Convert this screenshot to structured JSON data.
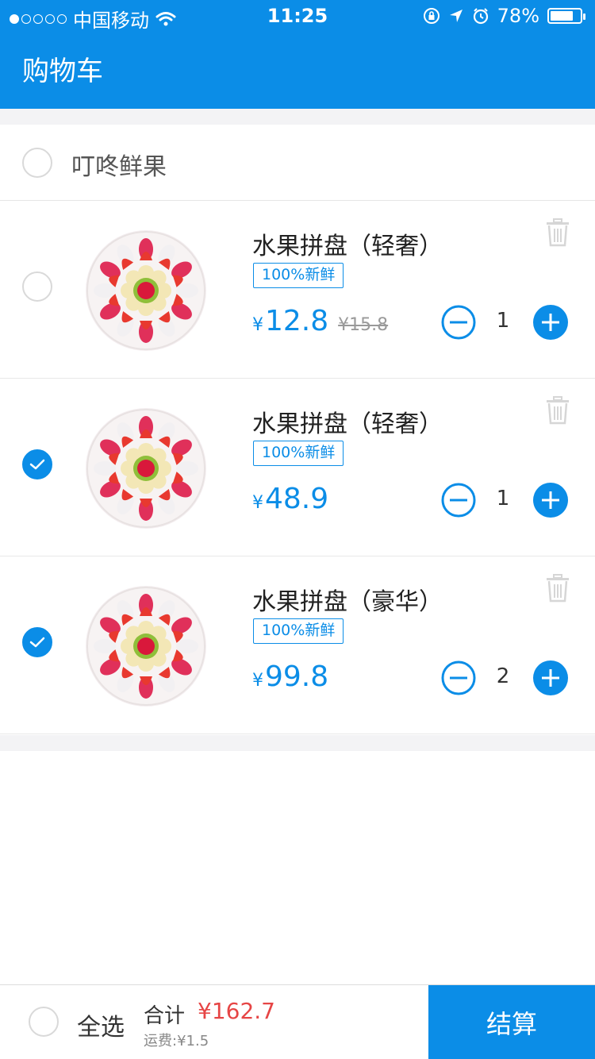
{
  "status_bar": {
    "carrier": "中国移动",
    "time": "11:25",
    "battery": "78%",
    "battery_level": 0.78
  },
  "header": {
    "title": "购物车"
  },
  "store": {
    "name": "叮咚鲜果",
    "checked": false
  },
  "items": [
    {
      "title": "水果拼盘（轻奢）",
      "tag": "100%新鲜",
      "currency": "¥",
      "price": "12.8",
      "original_price": "¥15.8",
      "quantity": "1",
      "checked": false
    },
    {
      "title": "水果拼盘（轻奢）",
      "tag": "100%新鲜",
      "currency": "¥",
      "price": "48.9",
      "original_price": "",
      "quantity": "1",
      "checked": true
    },
    {
      "title": "水果拼盘（豪华）",
      "tag": "100%新鲜",
      "currency": "¥",
      "price": "99.8",
      "original_price": "",
      "quantity": "2",
      "checked": true
    }
  ],
  "footer": {
    "select_all": "全选",
    "total_label": "合计",
    "total_value": "¥162.7",
    "shipping": "运费:¥1.5",
    "checkout": "结算"
  },
  "colors": {
    "primary": "#0b8de7",
    "price_red": "#e64545",
    "background_gray": "#f3f3f5"
  },
  "icons": {
    "minus": "minus-circle-icon",
    "plus": "plus-circle-icon",
    "trash": "trash-icon",
    "check": "check-icon",
    "wifi": "wifi-icon"
  }
}
